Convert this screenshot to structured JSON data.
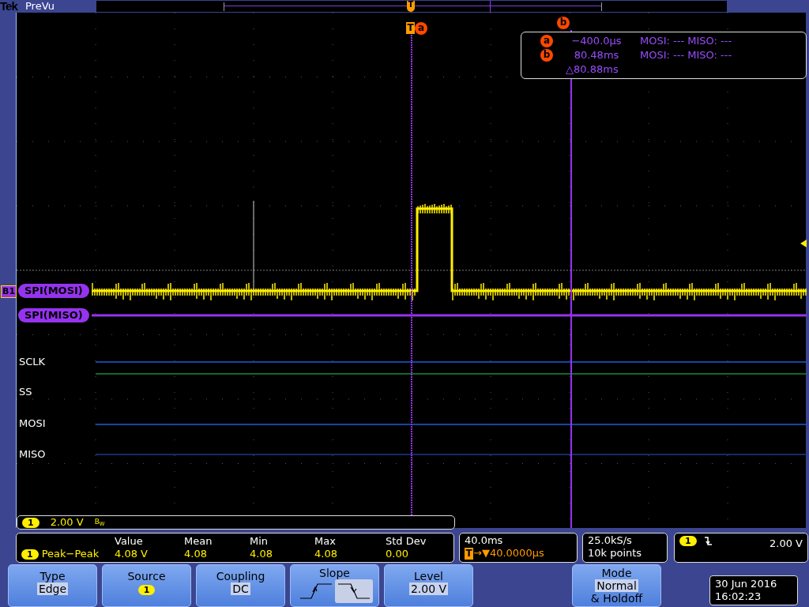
{
  "header": {
    "brand": "Tek",
    "mode": "PreVu"
  },
  "record_view": {
    "trigger_marker": "T"
  },
  "trigger_marker": {
    "label": "T",
    "cursor": "a"
  },
  "cursor_b_marker": "b",
  "cursors": [
    {
      "label": "a",
      "time": "−400.0µs",
      "readout": "MOSI: --- MISO: ---"
    },
    {
      "label": "b",
      "time": "80.48ms",
      "readout": "MOSI: --- MISO: ---"
    }
  ],
  "cursor_delta": "△80.88ms",
  "bus": {
    "badge": "B1",
    "rows": [
      "SPI(MOSI)",
      "SPI(MISO)"
    ]
  },
  "digital_channels": [
    "SCLK",
    "SS",
    "MOSI",
    "MISO"
  ],
  "channel_bar": {
    "channel": "1",
    "scale": "2.00 V",
    "bandwidth": "B$_{W}$"
  },
  "measurement": {
    "channel": "1",
    "name": "Peak−Peak",
    "columns": [
      "Value",
      "Mean",
      "Min",
      "Max",
      "Std Dev"
    ],
    "values": [
      "4.08 V",
      "4.08",
      "4.08",
      "4.08",
      "0.00"
    ]
  },
  "timebase": {
    "scale": "40.0ms",
    "trigger_icon": "T",
    "delay": "→▼40.0000µs"
  },
  "acquisition": {
    "rate": "25.0kS/s",
    "points": "10k points"
  },
  "trigger": {
    "channel": "1",
    "level": "2.00 V"
  },
  "buttons": [
    {
      "kind": "text",
      "title": "Type",
      "value": "Edge"
    },
    {
      "kind": "badge",
      "title": "Source",
      "value": "1"
    },
    {
      "kind": "text",
      "title": "Coupling",
      "value": "DC"
    },
    {
      "kind": "slope",
      "title": "Slope",
      "options": [
        {
          "kind": "rising",
          "selected": false
        },
        {
          "kind": "falling",
          "selected": true
        }
      ]
    },
    {
      "kind": "text",
      "title": "Level",
      "value": "2.00 V"
    },
    {
      "kind": "stacked",
      "title": "Mode",
      "value": "Normal",
      "extra": "& Holdoff"
    }
  ],
  "datetime": {
    "date": "30 Jun 2016",
    "time": "16:02:23"
  }
}
